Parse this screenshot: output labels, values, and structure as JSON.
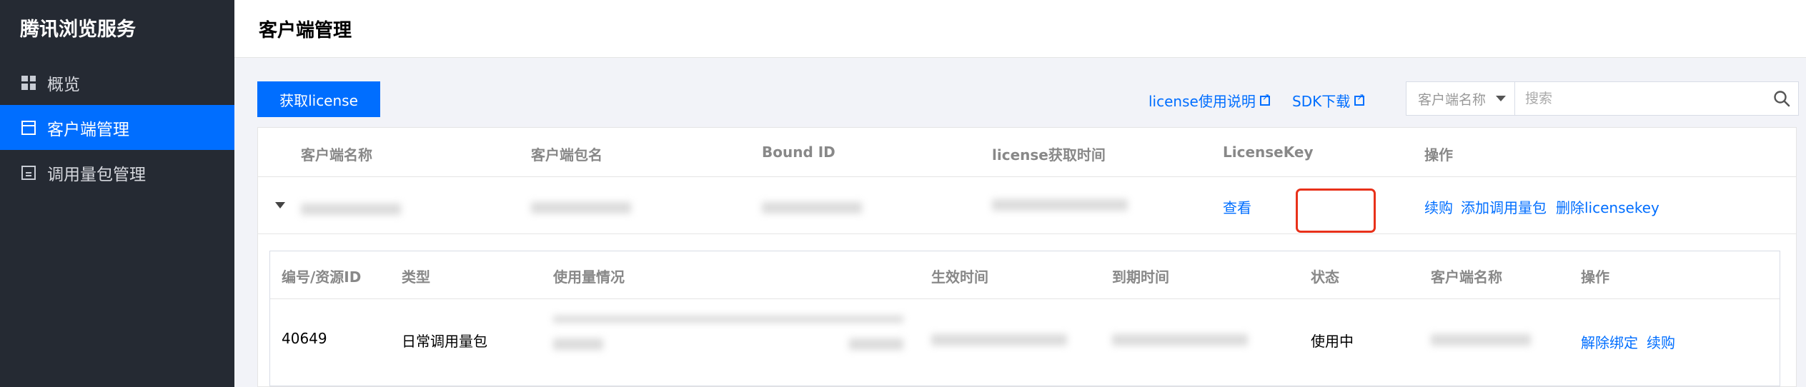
{
  "sidebar": {
    "brand": "腾讯浏览服务",
    "items": [
      {
        "label": "概览",
        "icon": "grid-icon"
      },
      {
        "label": "客户端管理",
        "icon": "window-icon",
        "active": true
      },
      {
        "label": "调用量包管理",
        "icon": "document-icon"
      }
    ]
  },
  "header": {
    "title": "客户端管理"
  },
  "toolbar": {
    "get_license_label": "获取license",
    "license_doc_link": "license使用说明",
    "sdk_download_link": "SDK下载",
    "search_select_value": "客户端名称",
    "search_placeholder": "搜索"
  },
  "table": {
    "columns": [
      "客户端名称",
      "客户端包名",
      "Bound ID",
      "license获取时间",
      "LicenseKey",
      "操作"
    ],
    "row": {
      "license_key_link": "查看",
      "actions": [
        "续购",
        "添加调用量包",
        "删除licensekey"
      ]
    }
  },
  "subtable": {
    "columns": [
      "编号/资源ID",
      "类型",
      "使用量情况",
      "生效时间",
      "到期时间",
      "状态",
      "客户端名称",
      "操作"
    ],
    "row": {
      "id": "40649",
      "type": "日常调用量包",
      "status": "使用中",
      "actions": [
        "解除绑定",
        "续购"
      ]
    }
  },
  "colors": {
    "accent": "#006eff",
    "sidebar_bg": "#252a33",
    "highlight": "#e8311a"
  }
}
